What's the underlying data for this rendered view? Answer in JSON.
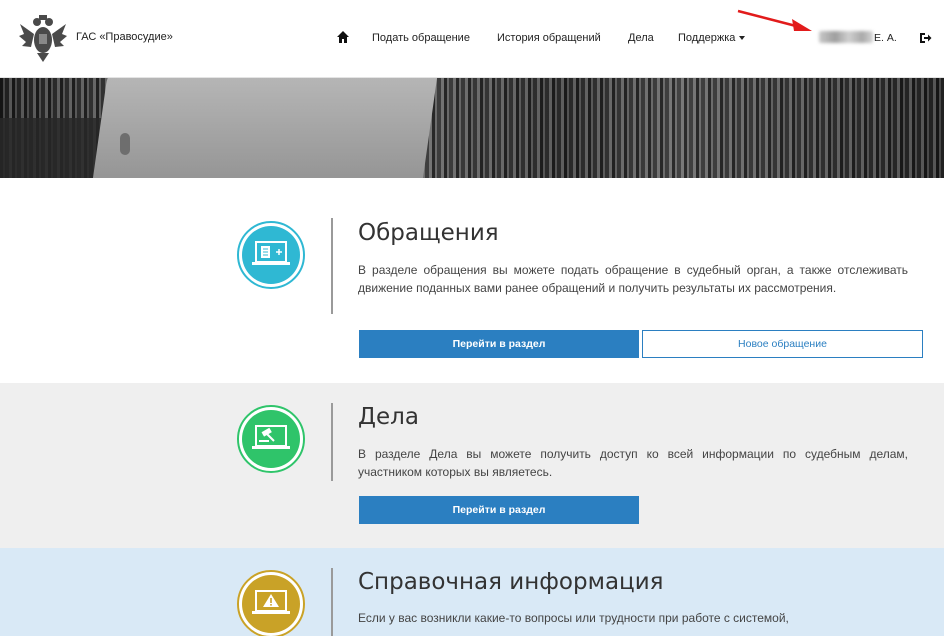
{
  "header": {
    "brand": "ГАС «Правосудие»",
    "logo_icon": "coat-of-arms-emblem",
    "home_icon": "home-icon",
    "nav": {
      "submit_appeal": "Подать обращение",
      "appeal_history": "История обращений",
      "cases": "Дела",
      "support": "Поддержка"
    },
    "user_name_suffix": "Е. А.",
    "logout_icon": "logout-icon"
  },
  "sections": {
    "appeals": {
      "icon": "document-add-icon",
      "title": "Обращения",
      "text": "В разделе обращения вы можете подать обращение в судебный орган, а также отслеживать движение поданных вами ранее обращений и получить результаты их рассмотрения.",
      "primary_button": "Перейти в раздел",
      "secondary_button": "Новое обращение"
    },
    "cases": {
      "icon": "gavel-icon",
      "title": "Дела",
      "text": "В разделе Дела вы можете получить доступ ко всей информации по судебным делам, участником которых вы являетесь.",
      "primary_button": "Перейти в раздел"
    },
    "info": {
      "icon": "warning-icon",
      "title": "Справочная информация",
      "text": "Если у вас возникли какие-то вопросы или трудности при работе с системой,"
    }
  },
  "colors": {
    "primary": "#2b7fc1",
    "appeals_circle": "#2fb8d3",
    "cases_circle": "#2fc46a",
    "info_circle": "#c9a227",
    "annotation_arrow": "#e21b1b"
  }
}
